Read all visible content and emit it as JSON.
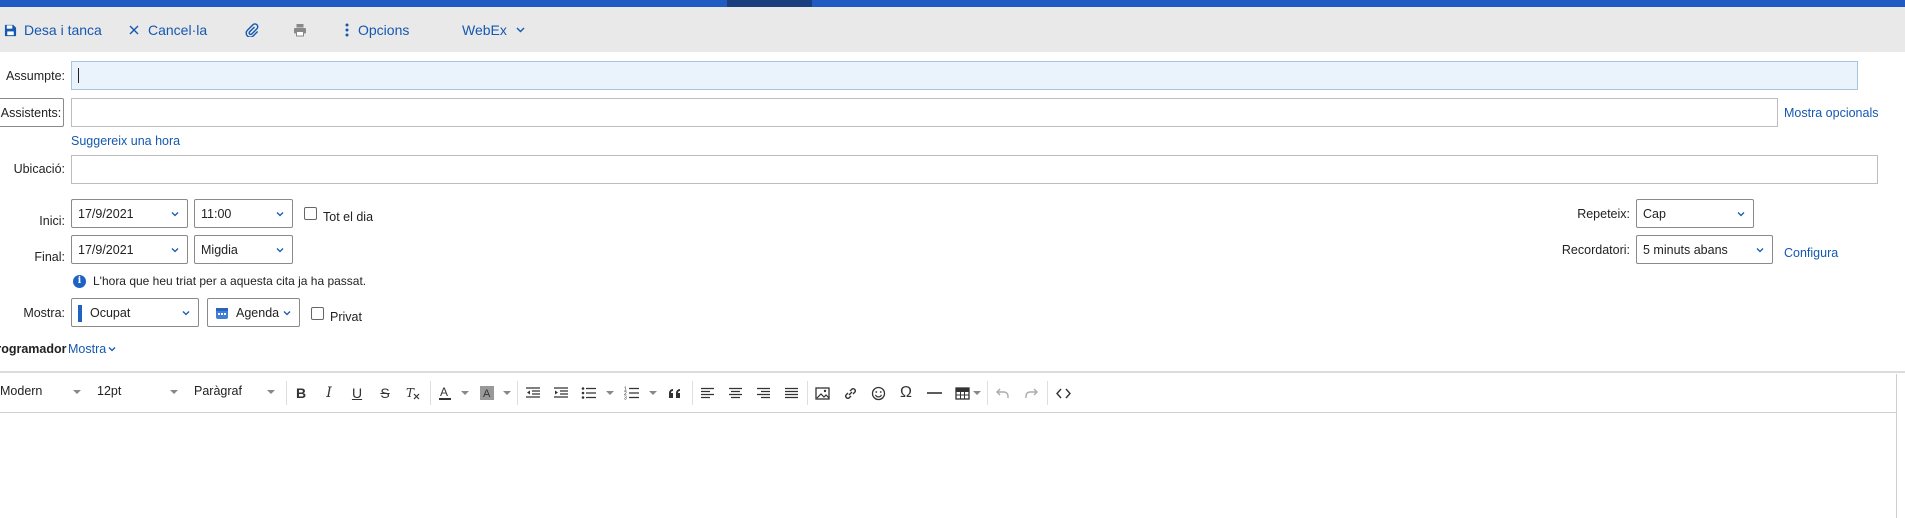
{
  "toolbar": {
    "save_close": "Desa i tanca",
    "cancel": "Cancel·la",
    "options": "Opcions",
    "webex": "WebEx"
  },
  "form": {
    "subject_label": "Assumpte:",
    "subject_value": "",
    "attendees_button": "Assistents:",
    "show_optional": "Mostra opcionals",
    "suggest_time": "Suggereix una hora",
    "location_label": "Ubicació:",
    "start_label": "Inici:",
    "start_date": "17/9/2021",
    "start_time": "11:00",
    "all_day_label": "Tot el dia",
    "end_label": "Final:",
    "end_date": "17/9/2021",
    "end_time": "Migdia",
    "repeat_label": "Repeteix:",
    "repeat_value": "Cap",
    "reminder_label": "Recordatori:",
    "reminder_value": "5 minuts abans",
    "configure": "Configura",
    "info_message": "L'hora que heu triat per a aquesta cita ja ha passat.",
    "show_as_label": "Mostra:",
    "show_as_value": "Ocupat",
    "show_as_color": "#1e63c4",
    "calendar_value": "Agenda",
    "private_label": "Privat",
    "scheduler_label": "Programador",
    "scheduler_toggle": "Mostra"
  },
  "editor": {
    "font_family": "Modern",
    "font_size": "12pt",
    "block_format": "Paràgraf"
  },
  "colors": {
    "accent": "#1558b0",
    "topbar": "#1f5bc2"
  }
}
